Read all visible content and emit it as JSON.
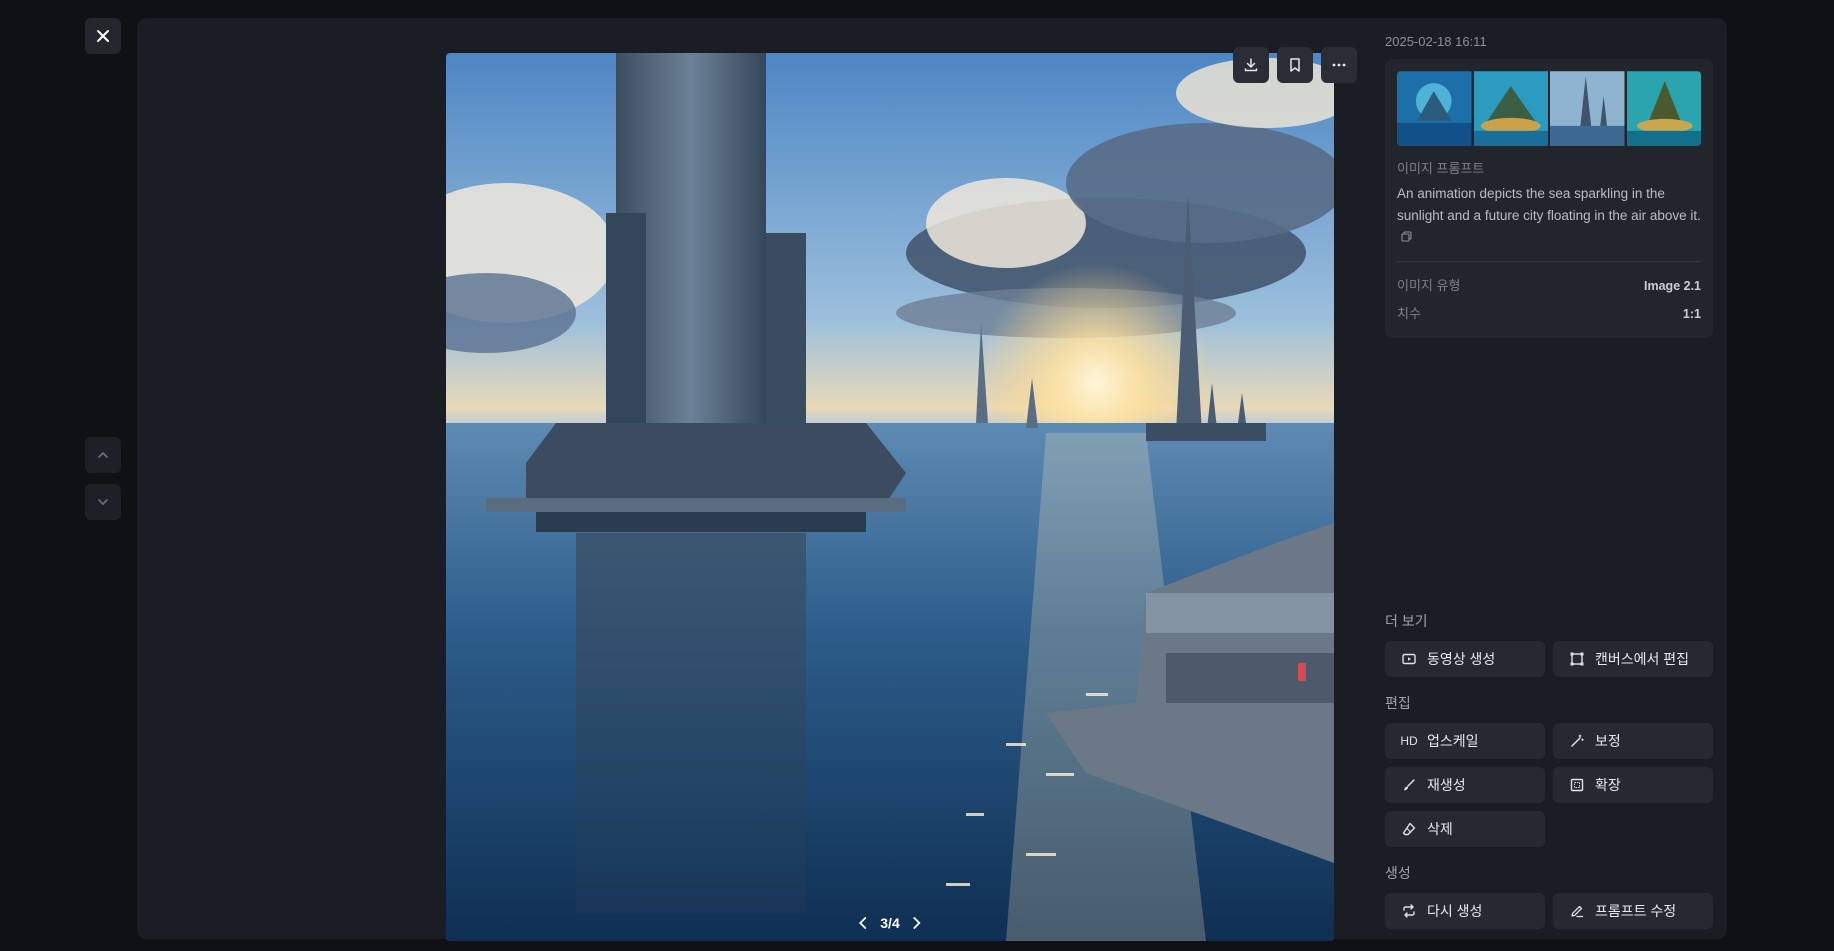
{
  "viewer": {
    "close_label": "✕",
    "pager": {
      "current": "3/4"
    }
  },
  "sidebar": {
    "timestamp": "2025-02-18 16:11",
    "prompt_label": "이미지 프롬프트",
    "prompt_text": "An animation depicts the sea sparkling in the sunlight and a future city floating in the air above it.",
    "meta": [
      {
        "key": "이미지 유형",
        "value": "Image 2.1"
      },
      {
        "key": "치수",
        "value": "1:1"
      }
    ]
  },
  "sections": {
    "more": {
      "title": "더 보기",
      "buttons": [
        {
          "label": "동영상 생성",
          "icon": "video-generate-icon"
        },
        {
          "label": "캔버스에서 편집",
          "icon": "canvas-edit-icon"
        }
      ]
    },
    "edit": {
      "title": "편집",
      "buttons": [
        {
          "label": "업스케일",
          "icon": "hd-icon",
          "icon_text": "HD"
        },
        {
          "label": "보정",
          "icon": "magic-wand-icon"
        },
        {
          "label": "재생성",
          "icon": "brush-icon"
        },
        {
          "label": "확장",
          "icon": "expand-icon"
        },
        {
          "label": "삭제",
          "icon": "eraser-icon"
        }
      ]
    },
    "generate": {
      "title": "생성",
      "buttons": [
        {
          "label": "다시 생성",
          "icon": "repeat-icon"
        },
        {
          "label": "프롬프트 수정",
          "icon": "pencil-icon"
        }
      ]
    }
  },
  "colors": {
    "background": "#0f1115",
    "panel": "#1a1d23",
    "button": "#262930",
    "accent_text": "#e6e8ec"
  }
}
